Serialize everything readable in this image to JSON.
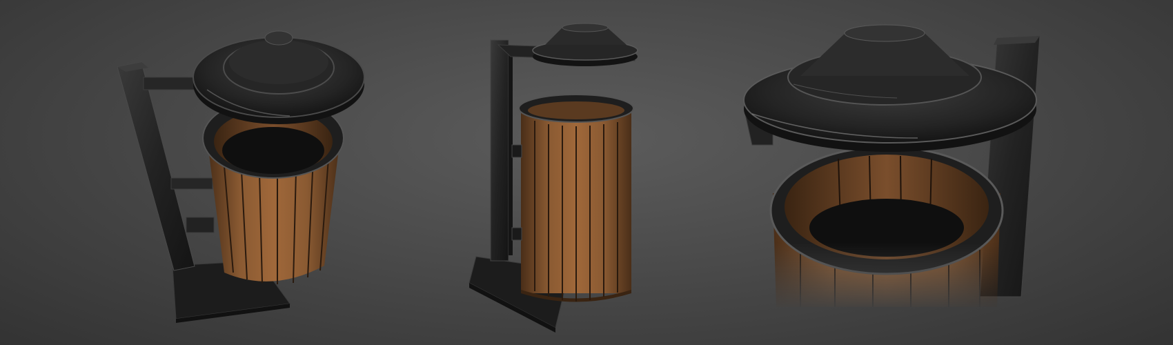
{
  "scene": {
    "views": [
      {
        "name": "three-quarter-top-view"
      },
      {
        "name": "side-view"
      },
      {
        "name": "close-up-view"
      }
    ]
  },
  "colors": {
    "background_center": "#5c5c5c",
    "background_edge": "#333333",
    "metal_dark": "#1f1f1f",
    "metal_mid": "#2e2e2e",
    "metal_highlight": "#8a8a8a",
    "wood_light": "#a0683a",
    "wood_mid": "#7a4e2c",
    "wood_dark": "#4a2e18",
    "interior_dark": "#0f0f0f"
  }
}
